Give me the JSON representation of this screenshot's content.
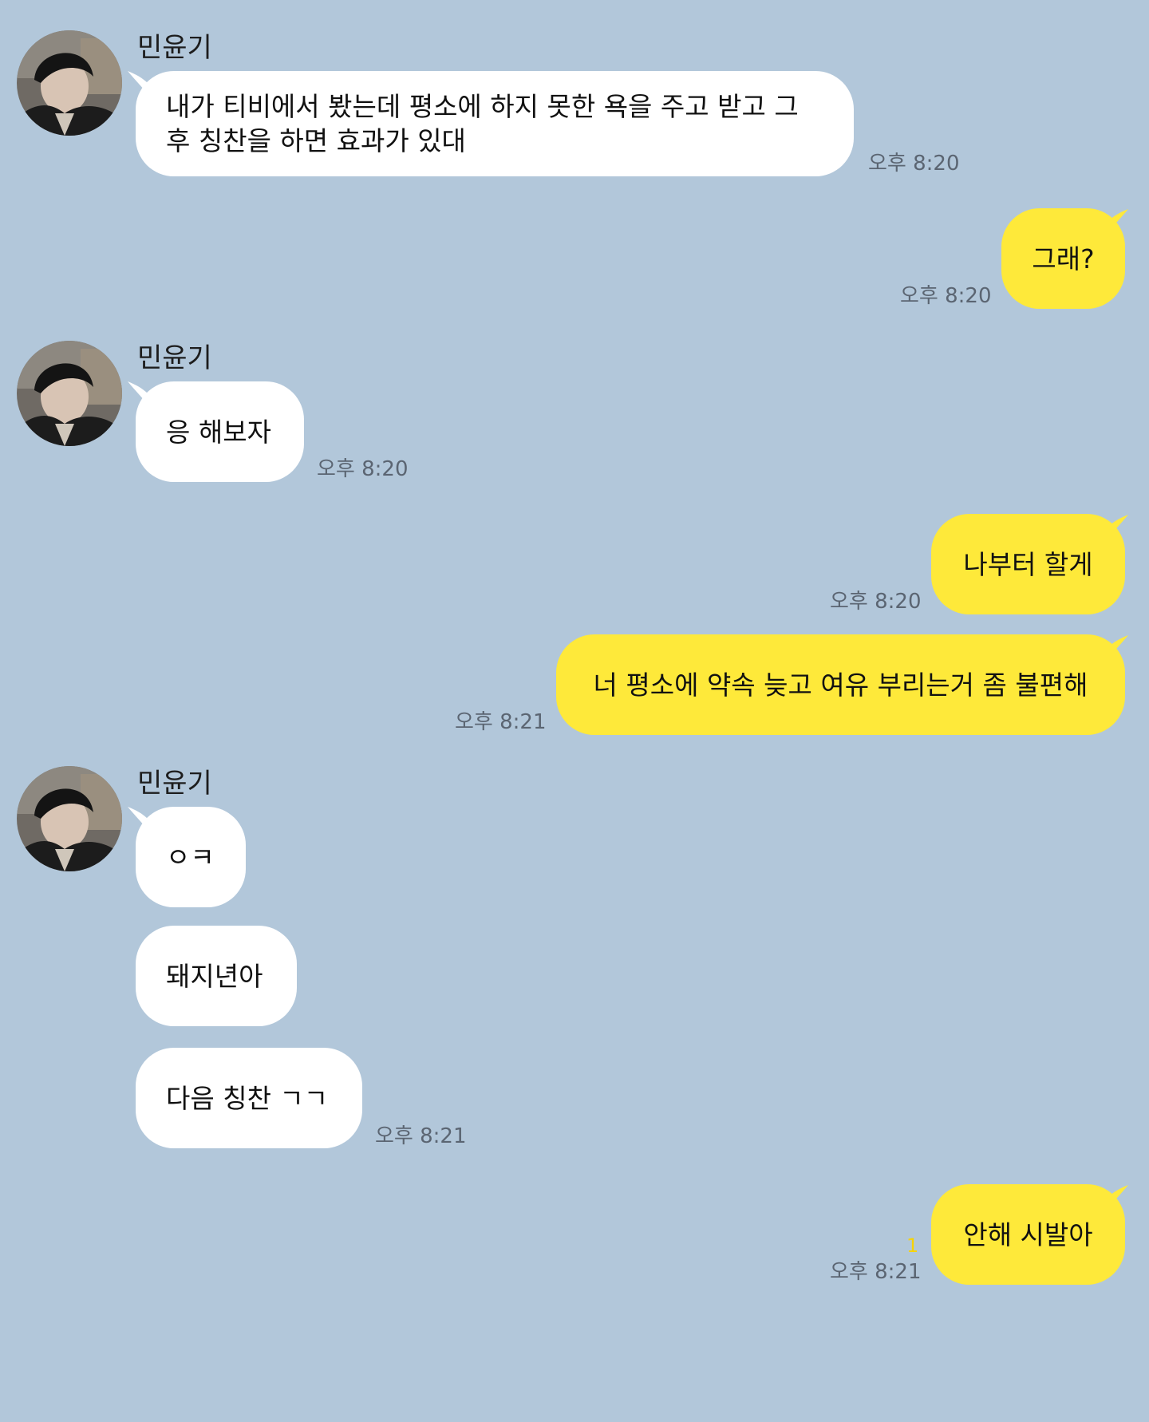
{
  "colors": {
    "background": "#b2c7da",
    "bubble_received": "#ffffff",
    "bubble_sent": "#fee93a",
    "timestamp": "#5b6572",
    "unread": "#f7d300"
  },
  "messages": [
    {
      "sender": "민윤기",
      "avatar": "profile-photo",
      "text": "내가 티비에서 봤는데 평소에 하지 못한 욕을 주고 받고 그 후 칭찬을 하면 효과가 있대",
      "time": "오후 8:20"
    },
    {
      "text": "그래?",
      "time": "오후 8:20"
    },
    {
      "sender": "민윤기",
      "avatar": "profile-photo",
      "text": "응 해보자",
      "time": "오후 8:20"
    },
    {
      "text": "나부터 할게",
      "time": "오후 8:20"
    },
    {
      "text": "너 평소에 약속 늦고 여유 부리는거 좀 불편해",
      "time": "오후 8:21"
    },
    {
      "sender": "민윤기",
      "avatar": "profile-photo",
      "text": "ㅇㅋ"
    },
    {
      "text": "돼지년아"
    },
    {
      "text": "다음 칭찬 ㄱㄱ",
      "time": "오후 8:21"
    },
    {
      "text": "안해 시발아",
      "unread": "1",
      "time": "오후 8:21"
    }
  ]
}
